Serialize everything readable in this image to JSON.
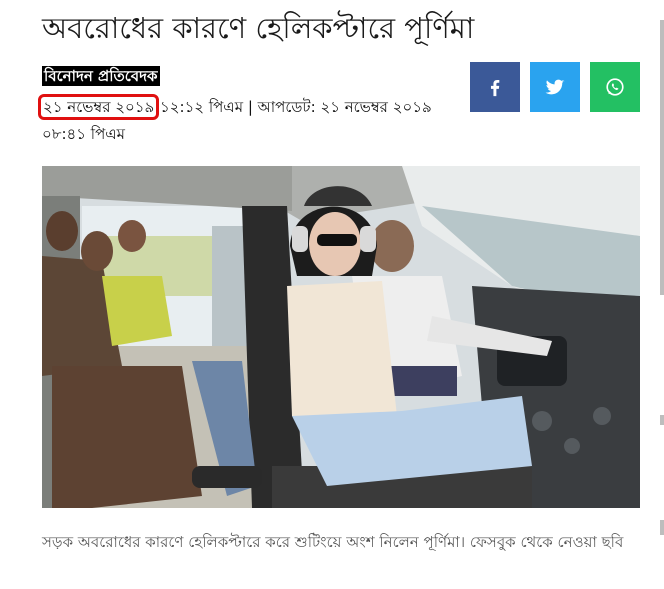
{
  "article": {
    "headline": "অবরোধের কারণে হেলিকপ্টারে পূর্ণিমা",
    "byline": "বিনোদন প্রতিবেদক",
    "published_date": "২১ নভেম্বর ২০১৯",
    "published_time": "১২:১২ পিএম",
    "separator": "|",
    "updated_label": "আপডেট:",
    "updated_datetime": "২১ নভেম্বর ২০১৯ ০৮:৪১ পিএম",
    "caption": "সড়ক অবরোধের কারণে হেলিকপ্টারে করে শুটিংয়ে অংশ নিলেন পূর্ণিমা। ফেসবুক থেকে নেওয়া ছবি"
  },
  "share": {
    "facebook_icon": "facebook-icon",
    "twitter_icon": "twitter-icon",
    "whatsapp_icon": "whatsapp-icon",
    "colors": {
      "facebook": "#3b5998",
      "twitter": "#2aa3ef",
      "whatsapp": "#23c063"
    }
  },
  "highlight_color": "#e01010"
}
